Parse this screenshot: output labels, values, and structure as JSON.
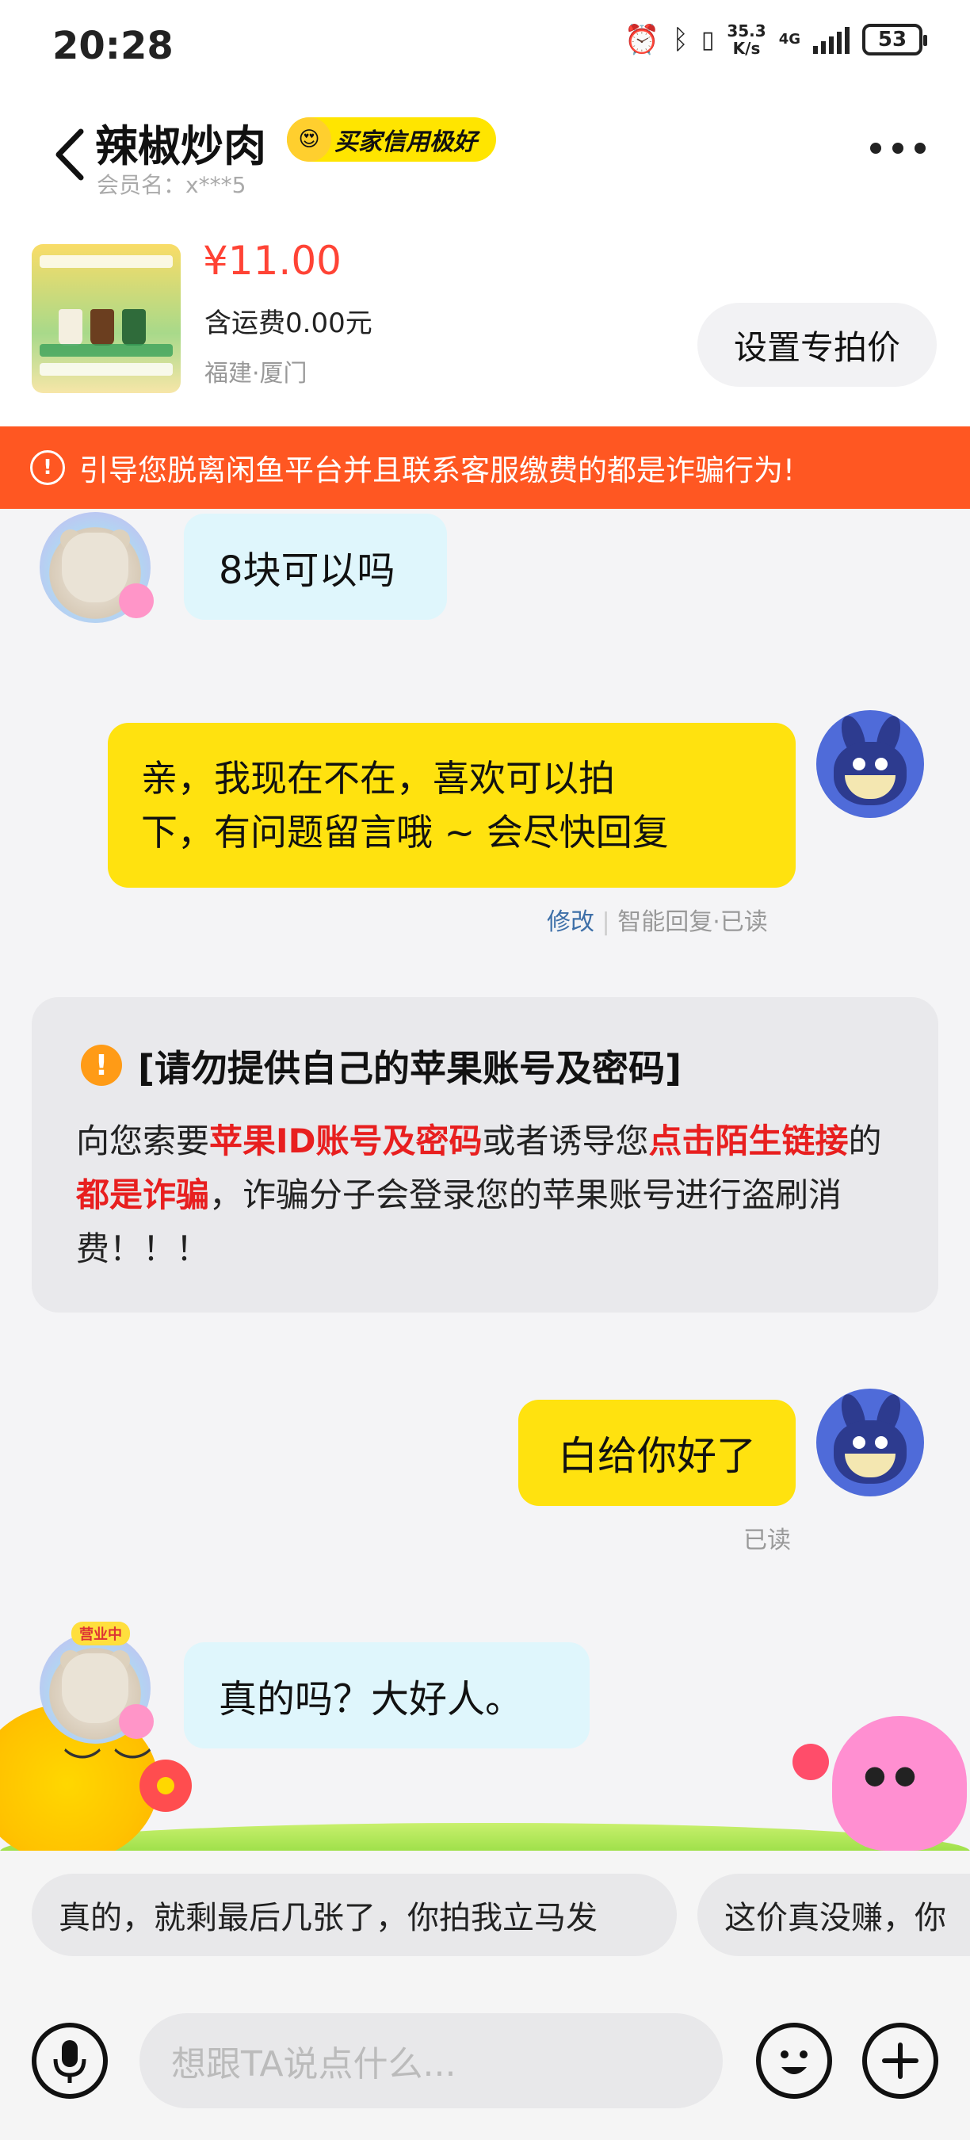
{
  "status_bar": {
    "time": "20:28",
    "net_speed_top": "35.3",
    "net_speed_bottom": "K/s",
    "network": "4G",
    "battery": "53"
  },
  "header": {
    "title": "辣椒炒肉",
    "badge": "买家信用极好",
    "member": "会员名：x***5"
  },
  "product": {
    "price": "¥11.00",
    "shipping": "含运费0.00元",
    "location": "福建·厦门",
    "set_price_label": "设置专拍价"
  },
  "warning_banner": "引导您脱离闲鱼平台并且联系客服缴费的都是诈骗行为!",
  "messages": [
    {
      "from": "seller",
      "text": "8块可以吗"
    },
    {
      "from": "me",
      "line1": "亲，我现在不在，喜欢可以拍",
      "line2": "下，有问题留言哦 ~ 会尽快回复",
      "meta_edit": "修改",
      "meta_rest": "智能回复·已读"
    },
    {
      "from": "me",
      "text": "白给你好了",
      "meta": "已读"
    },
    {
      "from": "seller",
      "text": "真的吗？大好人。"
    }
  ],
  "seller_tag": "营业中",
  "notice": {
    "title": "[请勿提供自己的苹果账号及密码]",
    "p1": "向您索要",
    "r1": "苹果ID账号及密码",
    "p2": "或者诱导您",
    "r2": "点击陌生链接",
    "p3": "的",
    "r3": "都是诈骗",
    "p4": "，诈骗分子会登录您的苹果账号进行盗刷消费！！！"
  },
  "suggestions": [
    "真的，就剩最后几张了，你拍我立马发",
    "这价真没赚，你"
  ],
  "input": {
    "placeholder": "想跟TA说点什么..."
  },
  "colors": {
    "accent_yellow": "#ffe20f",
    "warning_orange": "#ff5722",
    "price_red": "#ff4335",
    "seller_bubble": "#dff6fc"
  }
}
